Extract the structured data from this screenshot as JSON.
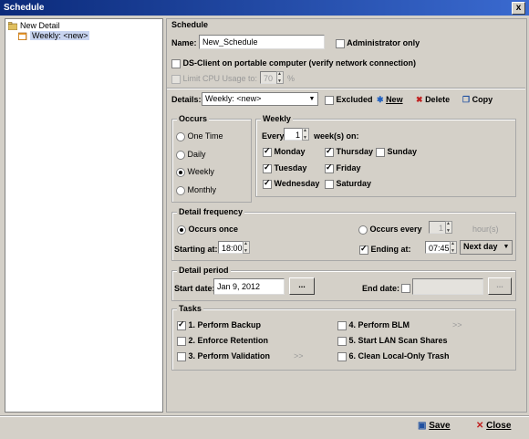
{
  "window": {
    "title": "Schedule",
    "close": "x"
  },
  "tree": {
    "root": "New Detail",
    "child": "Weekly: <new>"
  },
  "schedule": {
    "header": "Schedule",
    "name_label": "Name:",
    "name_value": "New_Schedule",
    "admin_only": "Administrator only",
    "portable": "DS-Client on portable computer (verify network connection)",
    "limit_cpu": "Limit CPU Usage to:",
    "limit_cpu_value": "70",
    "limit_cpu_unit": "%"
  },
  "details": {
    "label": "Details:",
    "selected": "Weekly: <new>",
    "excluded": "Excluded",
    "new": "New",
    "delete": "Delete",
    "copy": "Copy"
  },
  "occurs": {
    "header": "Occurs",
    "options": [
      "One Time",
      "Daily",
      "Weekly",
      "Monthly"
    ],
    "selected": "Weekly"
  },
  "weekly": {
    "header": "Weekly",
    "every": "Every",
    "every_value": "1",
    "weeks_on": "week(s) on:",
    "days": {
      "monday": "Monday",
      "tuesday": "Tuesday",
      "wednesday": "Wednesday",
      "thursday": "Thursday",
      "friday": "Friday",
      "saturday": "Saturday",
      "sunday": "Sunday"
    }
  },
  "frequency": {
    "header": "Detail frequency",
    "occurs_once": "Occurs once",
    "occurs_every": "Occurs every",
    "every_value": "1",
    "hours": "hour(s)",
    "starting_at": "Starting at:",
    "start_time": "18:00",
    "ending_at": "Ending at:",
    "end_time": "07:45",
    "next_day": "Next day"
  },
  "period": {
    "header": "Detail period",
    "start_date_label": "Start date:",
    "start_date": "Jan 9, 2012",
    "browse": "...",
    "end_date_label": "End date:",
    "end_date": ""
  },
  "tasks": {
    "header": "Tasks",
    "t1": "1. Perform Backup",
    "t2": "2. Enforce Retention",
    "t3": "3. Perform Validation",
    "t4": "4. Perform BLM",
    "t5": "5. Start LAN Scan Shares",
    "t6": "6. Clean Local-Only Trash",
    "more": ">>"
  },
  "footer": {
    "save": "Save",
    "close": "Close"
  },
  "colors": {
    "title_bar": "#0b2a7a",
    "selection": "#c8d4f0",
    "window_bg": "#d4d0c8"
  }
}
